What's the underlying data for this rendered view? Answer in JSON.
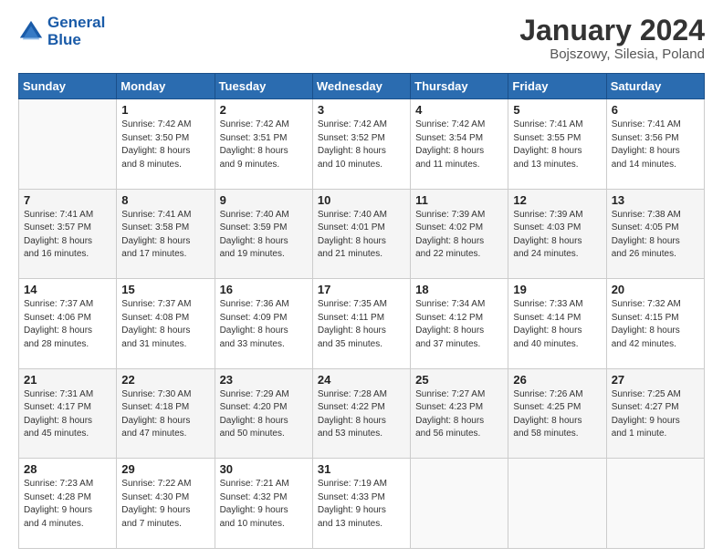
{
  "header": {
    "logo_line1": "General",
    "logo_line2": "Blue",
    "title": "January 2024",
    "subtitle": "Bojszowy, Silesia, Poland"
  },
  "calendar": {
    "days_header": [
      "Sunday",
      "Monday",
      "Tuesday",
      "Wednesday",
      "Thursday",
      "Friday",
      "Saturday"
    ],
    "weeks": [
      [
        {
          "day": "",
          "info": ""
        },
        {
          "day": "1",
          "info": "Sunrise: 7:42 AM\nSunset: 3:50 PM\nDaylight: 8 hours\nand 8 minutes."
        },
        {
          "day": "2",
          "info": "Sunrise: 7:42 AM\nSunset: 3:51 PM\nDaylight: 8 hours\nand 9 minutes."
        },
        {
          "day": "3",
          "info": "Sunrise: 7:42 AM\nSunset: 3:52 PM\nDaylight: 8 hours\nand 10 minutes."
        },
        {
          "day": "4",
          "info": "Sunrise: 7:42 AM\nSunset: 3:54 PM\nDaylight: 8 hours\nand 11 minutes."
        },
        {
          "day": "5",
          "info": "Sunrise: 7:41 AM\nSunset: 3:55 PM\nDaylight: 8 hours\nand 13 minutes."
        },
        {
          "day": "6",
          "info": "Sunrise: 7:41 AM\nSunset: 3:56 PM\nDaylight: 8 hours\nand 14 minutes."
        }
      ],
      [
        {
          "day": "7",
          "info": "Sunrise: 7:41 AM\nSunset: 3:57 PM\nDaylight: 8 hours\nand 16 minutes."
        },
        {
          "day": "8",
          "info": "Sunrise: 7:41 AM\nSunset: 3:58 PM\nDaylight: 8 hours\nand 17 minutes."
        },
        {
          "day": "9",
          "info": "Sunrise: 7:40 AM\nSunset: 3:59 PM\nDaylight: 8 hours\nand 19 minutes."
        },
        {
          "day": "10",
          "info": "Sunrise: 7:40 AM\nSunset: 4:01 PM\nDaylight: 8 hours\nand 21 minutes."
        },
        {
          "day": "11",
          "info": "Sunrise: 7:39 AM\nSunset: 4:02 PM\nDaylight: 8 hours\nand 22 minutes."
        },
        {
          "day": "12",
          "info": "Sunrise: 7:39 AM\nSunset: 4:03 PM\nDaylight: 8 hours\nand 24 minutes."
        },
        {
          "day": "13",
          "info": "Sunrise: 7:38 AM\nSunset: 4:05 PM\nDaylight: 8 hours\nand 26 minutes."
        }
      ],
      [
        {
          "day": "14",
          "info": "Sunrise: 7:37 AM\nSunset: 4:06 PM\nDaylight: 8 hours\nand 28 minutes."
        },
        {
          "day": "15",
          "info": "Sunrise: 7:37 AM\nSunset: 4:08 PM\nDaylight: 8 hours\nand 31 minutes."
        },
        {
          "day": "16",
          "info": "Sunrise: 7:36 AM\nSunset: 4:09 PM\nDaylight: 8 hours\nand 33 minutes."
        },
        {
          "day": "17",
          "info": "Sunrise: 7:35 AM\nSunset: 4:11 PM\nDaylight: 8 hours\nand 35 minutes."
        },
        {
          "day": "18",
          "info": "Sunrise: 7:34 AM\nSunset: 4:12 PM\nDaylight: 8 hours\nand 37 minutes."
        },
        {
          "day": "19",
          "info": "Sunrise: 7:33 AM\nSunset: 4:14 PM\nDaylight: 8 hours\nand 40 minutes."
        },
        {
          "day": "20",
          "info": "Sunrise: 7:32 AM\nSunset: 4:15 PM\nDaylight: 8 hours\nand 42 minutes."
        }
      ],
      [
        {
          "day": "21",
          "info": "Sunrise: 7:31 AM\nSunset: 4:17 PM\nDaylight: 8 hours\nand 45 minutes."
        },
        {
          "day": "22",
          "info": "Sunrise: 7:30 AM\nSunset: 4:18 PM\nDaylight: 8 hours\nand 47 minutes."
        },
        {
          "day": "23",
          "info": "Sunrise: 7:29 AM\nSunset: 4:20 PM\nDaylight: 8 hours\nand 50 minutes."
        },
        {
          "day": "24",
          "info": "Sunrise: 7:28 AM\nSunset: 4:22 PM\nDaylight: 8 hours\nand 53 minutes."
        },
        {
          "day": "25",
          "info": "Sunrise: 7:27 AM\nSunset: 4:23 PM\nDaylight: 8 hours\nand 56 minutes."
        },
        {
          "day": "26",
          "info": "Sunrise: 7:26 AM\nSunset: 4:25 PM\nDaylight: 8 hours\nand 58 minutes."
        },
        {
          "day": "27",
          "info": "Sunrise: 7:25 AM\nSunset: 4:27 PM\nDaylight: 9 hours\nand 1 minute."
        }
      ],
      [
        {
          "day": "28",
          "info": "Sunrise: 7:23 AM\nSunset: 4:28 PM\nDaylight: 9 hours\nand 4 minutes."
        },
        {
          "day": "29",
          "info": "Sunrise: 7:22 AM\nSunset: 4:30 PM\nDaylight: 9 hours\nand 7 minutes."
        },
        {
          "day": "30",
          "info": "Sunrise: 7:21 AM\nSunset: 4:32 PM\nDaylight: 9 hours\nand 10 minutes."
        },
        {
          "day": "31",
          "info": "Sunrise: 7:19 AM\nSunset: 4:33 PM\nDaylight: 9 hours\nand 13 minutes."
        },
        {
          "day": "",
          "info": ""
        },
        {
          "day": "",
          "info": ""
        },
        {
          "day": "",
          "info": ""
        }
      ]
    ]
  }
}
